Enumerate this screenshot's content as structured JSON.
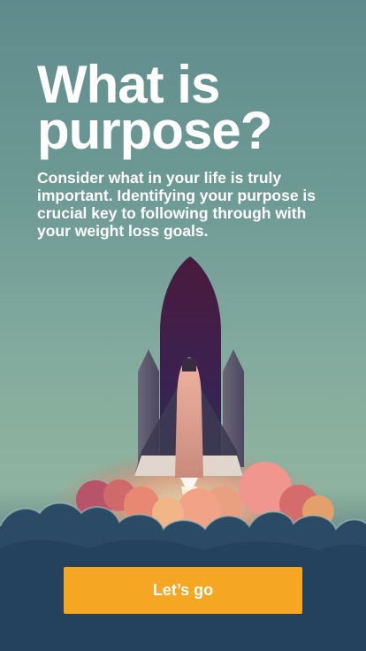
{
  "onboarding": {
    "title": "What is purpose?",
    "description": "Consider what in your life is truly important. Identifying your purpose is crucial key to following through with your weight loss goals.",
    "cta_label": "Let’s go"
  },
  "colors": {
    "accent": "#f5a623",
    "background_top": "#5f8b8c",
    "background_bottom": "#1f3a52"
  },
  "illustration": "space-shuttle-launch"
}
